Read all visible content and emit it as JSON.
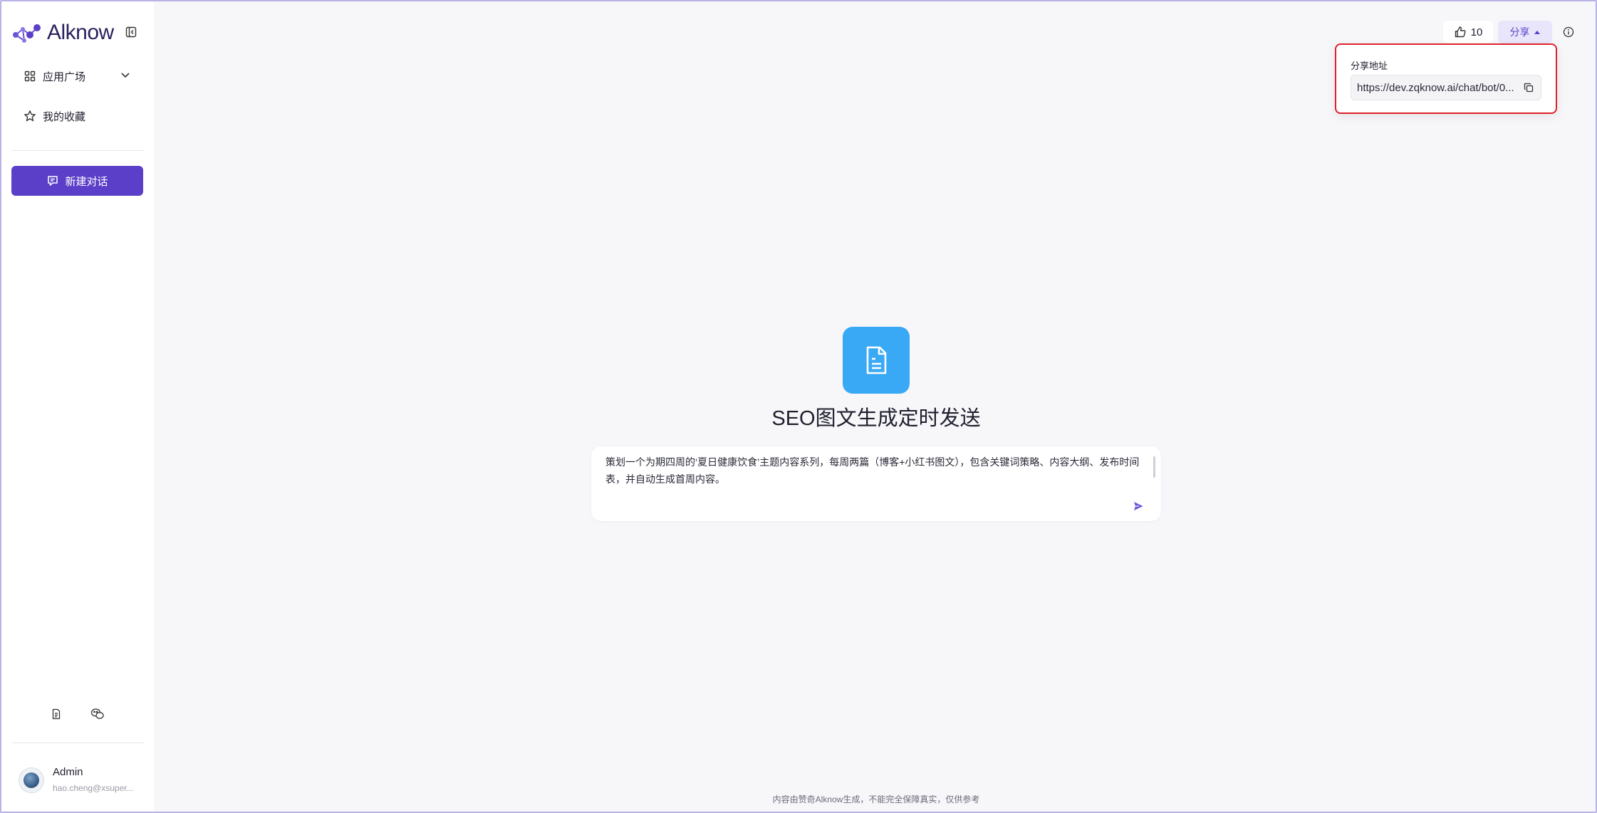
{
  "sidebar": {
    "logo_text": "Alknow",
    "nav": [
      {
        "label": "应用广场",
        "icon": "grid-icon"
      },
      {
        "label": "我的收藏",
        "icon": "star-icon"
      }
    ],
    "new_chat_label": "新建对话",
    "user": {
      "name": "Admin",
      "email": "hao.cheng@xsuper..."
    }
  },
  "toolbar": {
    "like_count": "10",
    "share_label": "分享"
  },
  "share_popover": {
    "title": "分享地址",
    "url": "https://dev.zqknow.ai/chat/bot/0..."
  },
  "main": {
    "app_title": "SEO图文生成定时发送",
    "input_text": "策划一个为期四周的‘夏日健康饮食’主题内容系列，每周两篇（博客+小红书图文），包含关键词策略、内容大纲、发布时间表，并自动生成首周内容。",
    "footer_note": "内容由赞奇Alknow生成，不能完全保障真实，仅供参考"
  },
  "colors": {
    "brand": "#5b3fc8",
    "app_icon_bg": "#3aa9f5",
    "highlight_border": "#e0202a"
  }
}
